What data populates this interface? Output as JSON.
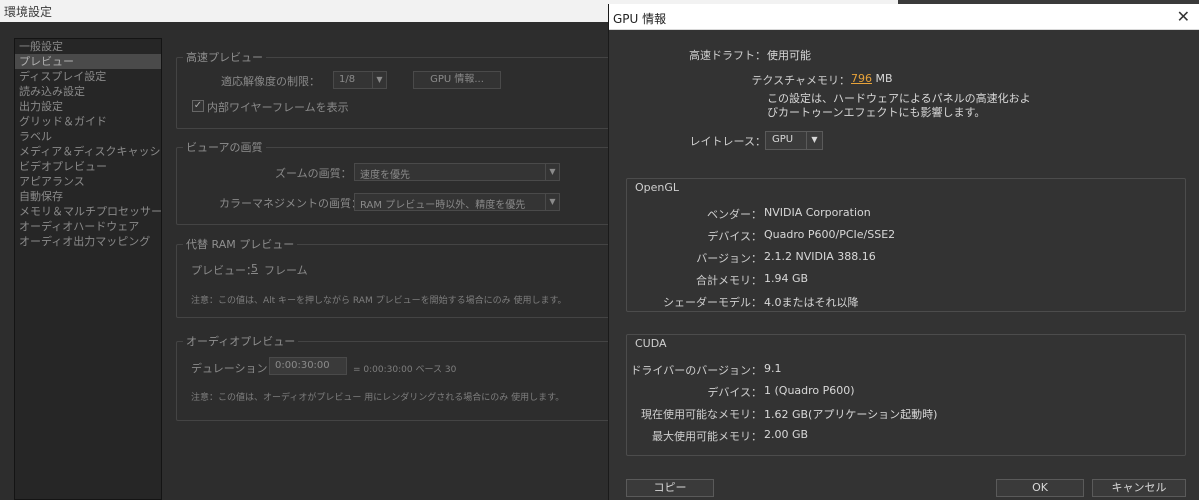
{
  "background_window": {
    "title": "環境設定",
    "nav_items": [
      "一般設定",
      "プレビュー",
      "ディスプレイ設定",
      "読み込み設定",
      "出力設定",
      "グリッド＆ガイド",
      "ラベル",
      "メディア＆ディスクキャッシュ",
      "ビデオプレビュー",
      "アピアランス",
      "自動保存",
      "メモリ＆マルチプロセッサー",
      "オーディオハードウェア",
      "オーディオ出力マッピング"
    ],
    "selected_nav": "プレビュー",
    "fast_preview": {
      "title": "高速プレビュー",
      "resolution_limit_label": "適応解像度の制限：",
      "resolution_limit_value": "1/8",
      "gpu_info_button": "GPU 情報...",
      "wireframe_checkbox_label": "内部ワイヤーフレームを表示",
      "wireframe_checked": true
    },
    "viewer_quality": {
      "title": "ビューアの画質",
      "zoom_label": "ズームの画質：",
      "zoom_value": "速度を優先",
      "color_mgmt_label": "カラーマネジメントの画質：",
      "color_mgmt_value": "RAM プレビュー時以外、精度を優先"
    },
    "alt_ram_preview": {
      "title": "代替 RAM プレビュー",
      "preview_label": "プレビュー：",
      "preview_frames": "5",
      "frames_unit": "フレーム",
      "note": "注意：この値は、Alt キーを押しながら RAM プレビューを開始する場合にのみ 使用します。"
    },
    "audio_preview": {
      "title": "オーディオプレビュー",
      "duration_label": "デュレーション：",
      "duration_value": "0:00:30:00",
      "duration_info": "= 0:00:30:00  ベース 30",
      "note": "注意：この値は、オーディオがプレビュー 用にレンダリングされる場合にのみ 使用します。"
    }
  },
  "gpu_dialog": {
    "title": "GPU 情報",
    "close_glyph": "✕",
    "fast_draft_label": "高速ドラフト：",
    "fast_draft_value": "使用可能",
    "texture_memory_label": "テクスチャメモリ：",
    "texture_memory_value": "796",
    "texture_memory_unit": "MB",
    "info_line1": "この設定は、ハードウェアによるパネルの高速化およ",
    "info_line2": "びカートゥーンエフェクトにも影響します。",
    "raytrace_label": "レイトレース：",
    "raytrace_value": "GPU",
    "opengl": {
      "title": "OpenGL",
      "rows": [
        {
          "label": "ベンダー：",
          "value": "NVIDIA Corporation"
        },
        {
          "label": "デバイス：",
          "value": "Quadro P600/PCIe/SSE2"
        },
        {
          "label": "バージョン：",
          "value": "2.1.2 NVIDIA 388.16"
        },
        {
          "label": "合計メモリ：",
          "value": "1.94 GB"
        },
        {
          "label": "シェーダーモデル：",
          "value": "4.0またはそれ以降"
        }
      ]
    },
    "cuda": {
      "title": "CUDA",
      "rows": [
        {
          "label": "ドライバーのバージョン：",
          "value": "9.1"
        },
        {
          "label": "デバイス：",
          "value": "1 (Quadro P600)"
        },
        {
          "label": "現在使用可能なメモリ：",
          "value": "1.62 GB(アプリケーション起動時)"
        },
        {
          "label": "最大使用可能メモリ：",
          "value": "2.00 GB"
        }
      ]
    },
    "copy_button": "コピー",
    "ok_button": "OK",
    "cancel_button": "キャンセル"
  },
  "colors": {
    "accent": "#e8a33a",
    "dialog_bg": "#333333",
    "panel_bg": "#2d2d2d"
  }
}
